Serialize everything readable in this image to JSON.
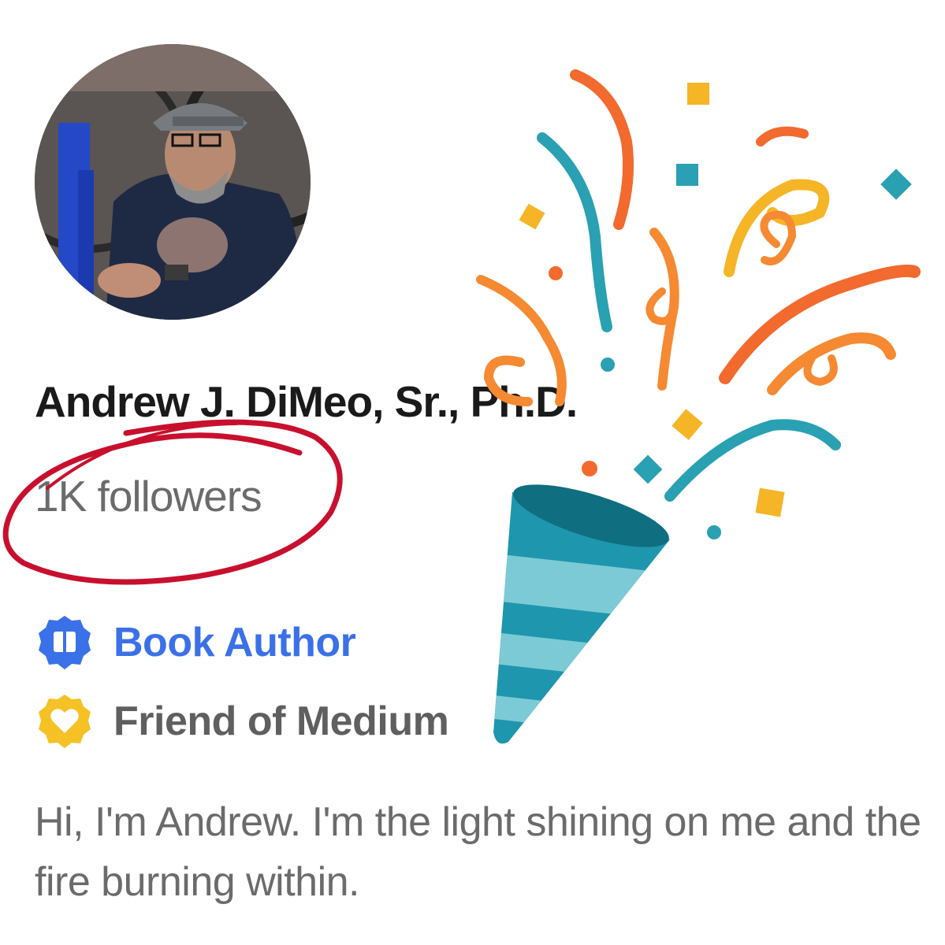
{
  "profile": {
    "name": "Andrew J. DiMeo, Sr., Ph.D.",
    "followers": "1K followers",
    "avatar_alt": "avatar"
  },
  "badges": [
    {
      "label": "Book Author",
      "icon": "book-badge-icon",
      "color": "#3b71e8"
    },
    {
      "label": "Friend of Medium",
      "icon": "heart-badge-icon",
      "color": "#f5c125"
    }
  ],
  "bio": "Hi, I'm Andrew. I'm the light shining on me and the fire burning within.",
  "decorations": {
    "highlight_circle_color": "#c8102e",
    "party_popper_icon": "party-popper-icon"
  }
}
